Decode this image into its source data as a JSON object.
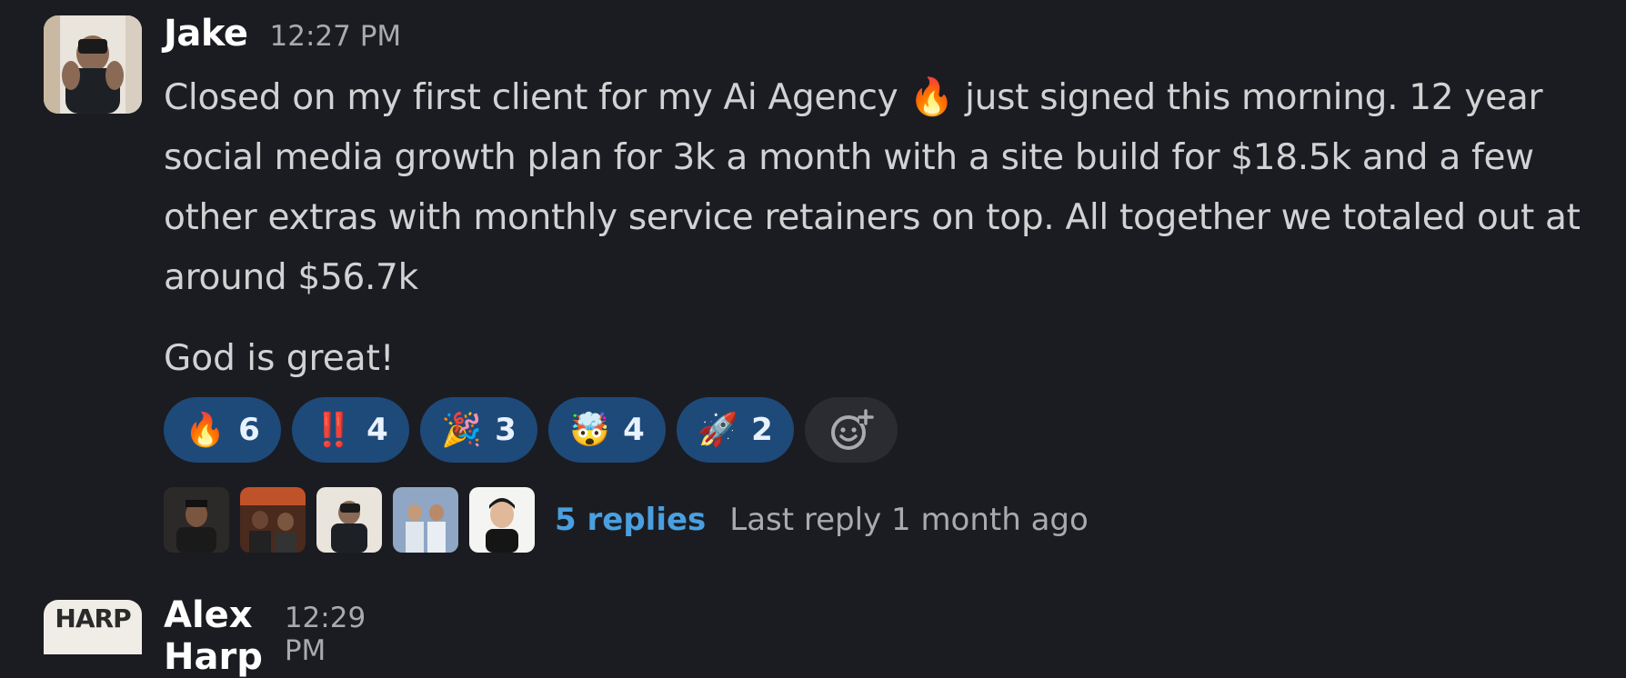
{
  "message": {
    "author": "Jake",
    "timestamp": "12:27 PM",
    "body_part1": "Closed on my first client for my Ai Agency ",
    "fire_emoji": "🔥",
    "body_part2": " just signed this morning. 12 year social media growth plan for 3k a month with a site build for $18.5k and a few other extras with monthly service retainers on top. All together we totaled out at around $56.7k",
    "body_second_paragraph": "God is great!",
    "reactions": [
      {
        "emoji": "🔥",
        "count": "6"
      },
      {
        "emoji": "‼️",
        "count": "4"
      },
      {
        "emoji": "🎉",
        "count": "3"
      },
      {
        "emoji": "🤯",
        "count": "4"
      },
      {
        "emoji": "🚀",
        "count": "2"
      }
    ],
    "thread": {
      "replies_label": "5 replies",
      "last_reply": "Last reply 1 month ago"
    }
  },
  "next_message": {
    "author": "Alex Harp",
    "timestamp": "12:29 PM",
    "avatar_text": "HARP"
  },
  "colors": {
    "background": "#1b1c21",
    "reaction_bg": "#1e4a7a",
    "link": "#4a9fe0"
  }
}
